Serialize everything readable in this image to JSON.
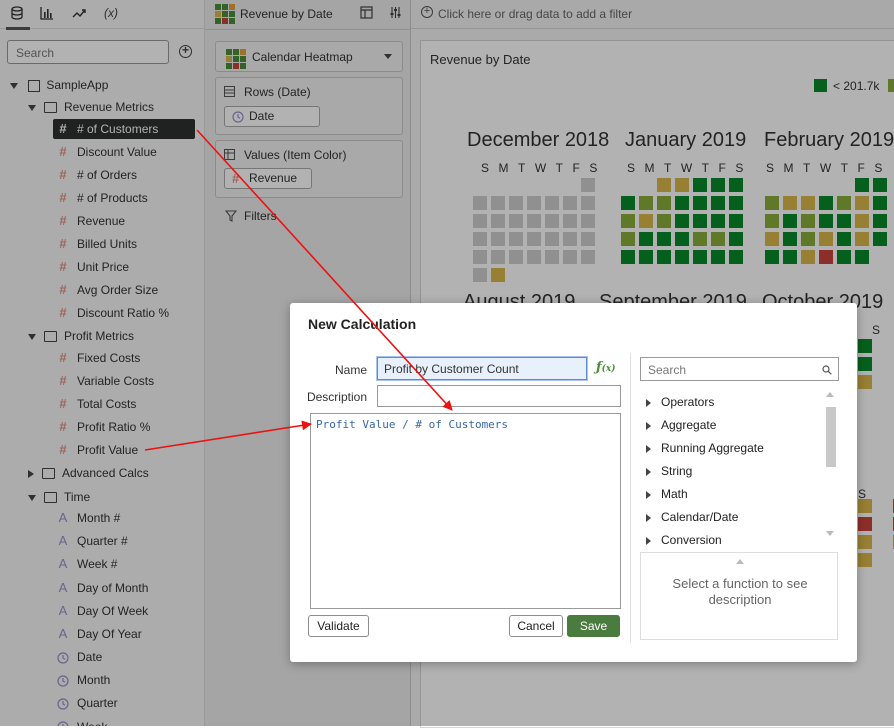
{
  "colors": {
    "accent_green": "#4a7c3f",
    "selected_bg": "#2f3030",
    "arrow_red": "#ee1111",
    "heat_dark_green": "#0a8a2a",
    "heat_light_green": "#8aae3a",
    "heat_yellow": "#d8b74a",
    "heat_red": "#c9443c",
    "heat_gray": "#cfcfcf"
  },
  "left_panel": {
    "tabs": [
      {
        "icon": "database-icon",
        "glyph": "⛁"
      },
      {
        "icon": "bar-chart-icon",
        "glyph": "▥"
      },
      {
        "icon": "trend-icon",
        "glyph": "↗"
      },
      {
        "icon": "function-icon",
        "glyph": "(x)"
      }
    ],
    "search_placeholder": "Search",
    "tree": {
      "root": "SampleApp",
      "revenue_folder": "Revenue Metrics",
      "revenue_items": [
        "# of Customers",
        "Discount Value",
        "# of Orders",
        "# of Products",
        "Revenue",
        "Billed Units",
        "Unit Price",
        "Avg Order Size",
        "Discount Ratio %"
      ],
      "profit_folder": "Profit Metrics",
      "profit_items": [
        "Fixed Costs",
        "Variable Costs",
        "Total Costs",
        "Profit Ratio %",
        "Profit Value"
      ],
      "advanced_folder": "Advanced Calcs",
      "time_folder": "Time",
      "time_attr_items": [
        "Month #",
        "Quarter #",
        "Week #",
        "Day of Month",
        "Day Of Week",
        "Day Of Year"
      ],
      "time_date_items": [
        "Date",
        "Month",
        "Quarter",
        "Week"
      ]
    }
  },
  "grammar": {
    "canvas_tab": "Revenue by Date",
    "viz_type": "Calendar Heatmap",
    "rows_title": "Rows (Date)",
    "rows_pill": "Date",
    "values_title": "Values (Item Color)",
    "values_pill": "Revenue",
    "filters_label": "Filters"
  },
  "canvas": {
    "filter_prompt": "Click here or drag data to add a filter",
    "viz_title": "Revenue by Date",
    "legend_label": "< 201.7k",
    "months_top": [
      "December 2018",
      "January 2019",
      "February 2019"
    ],
    "months_bottom": [
      "August 2019",
      "September 2019",
      "October 2019"
    ],
    "dow_letters": "SMTWTFS",
    "dow_partial": "S"
  },
  "dialog": {
    "title": "New Calculation",
    "name_label": "Name",
    "name_value": "Profit by Customer Count",
    "fx_label": "f(x)",
    "description_label": "Description",
    "description_value": "",
    "expression": "Profit Value / # of Customers",
    "function_search_placeholder": "Search",
    "function_categories": [
      "Operators",
      "Aggregate",
      "Running Aggregate",
      "String",
      "Math",
      "Calendar/Date",
      "Conversion"
    ],
    "function_hint": "Select a function to see description",
    "validate_label": "Validate",
    "cancel_label": "Cancel",
    "save_label": "Save"
  }
}
